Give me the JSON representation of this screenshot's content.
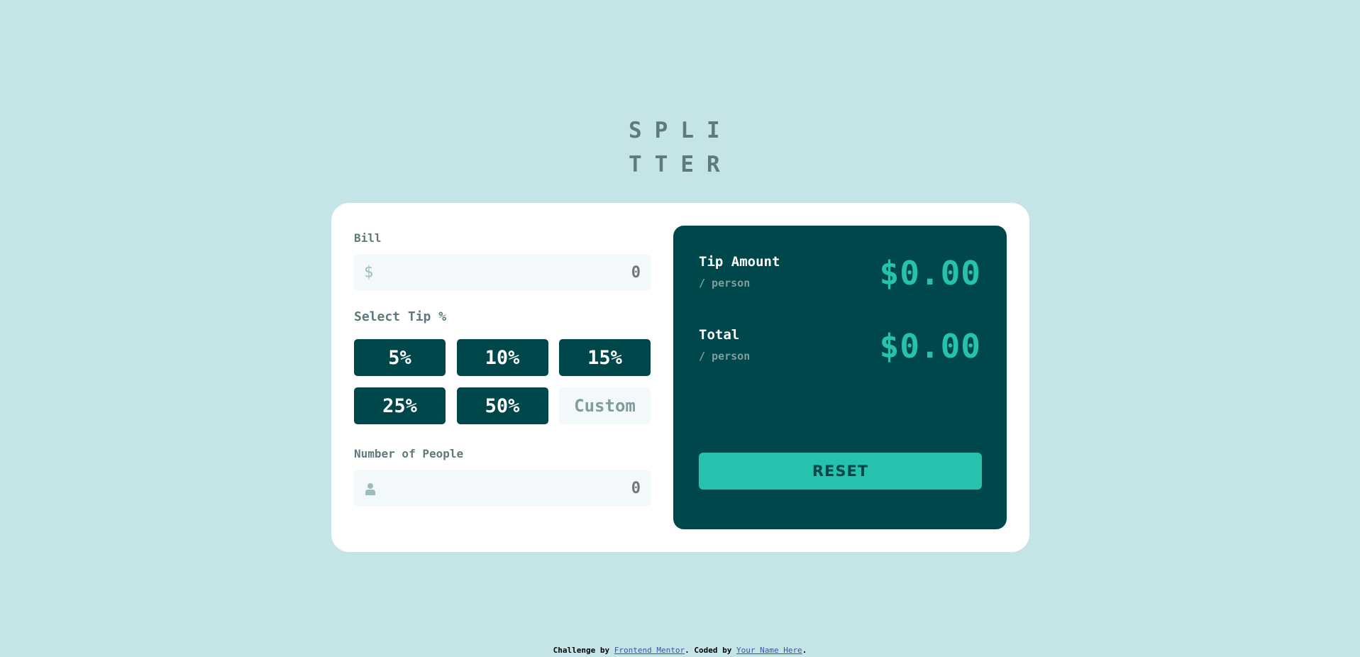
{
  "logo": {
    "line1": "SPLI",
    "line2": "TTER"
  },
  "form": {
    "bill": {
      "label": "Bill",
      "prefix_icon": "dollar-icon",
      "prefix_glyph": "$",
      "value": "",
      "placeholder": "0"
    },
    "tip": {
      "label": "Select Tip %",
      "options": [
        "5%",
        "10%",
        "15%",
        "25%",
        "50%"
      ],
      "custom_placeholder": "Custom"
    },
    "people": {
      "label": "Number of People",
      "prefix_icon": "person-icon",
      "value": "",
      "placeholder": "0"
    }
  },
  "results": {
    "tip_amount": {
      "title": "Tip Amount",
      "subtitle": "/ person",
      "value": "$0.00"
    },
    "total": {
      "title": "Total",
      "subtitle": "/ person",
      "value": "$0.00"
    },
    "reset_label": "RESET"
  },
  "footer": {
    "prefix": "Challenge by ",
    "link1": "Frontend Mentor",
    "middle": ". Coded by ",
    "link2": "Your Name Here",
    "suffix": "."
  },
  "colors": {
    "background": "#c5e4e7",
    "dark_teal": "#00474b",
    "accent": "#26c2ae",
    "label_gray": "#5e7a7d",
    "input_bg": "#f3f9fa"
  }
}
